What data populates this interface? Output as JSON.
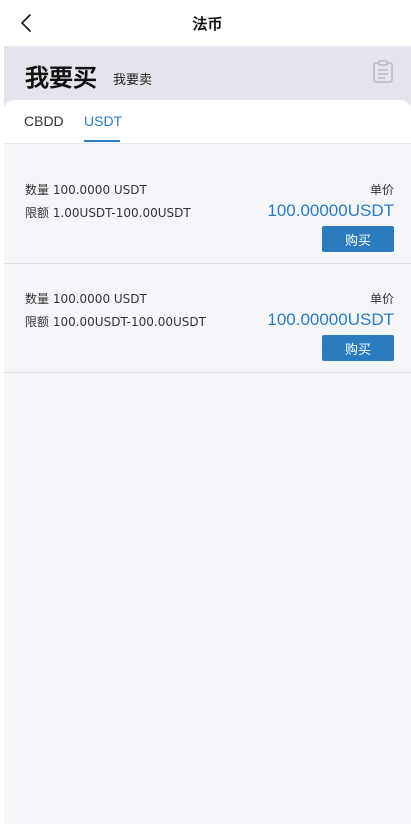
{
  "header": {
    "title": "法币"
  },
  "hero": {
    "buy_label": "我要买",
    "sell_label": "我要卖"
  },
  "tabs": [
    {
      "label": "CBDD",
      "active": false
    },
    {
      "label": "USDT",
      "active": true
    }
  ],
  "offers": [
    {
      "quantity_text": "数量 100.0000 USDT",
      "limit_text": "限额 1.00USDT-100.00USDT",
      "unit_price_label": "单价",
      "price": "100.00000USDT",
      "action_label": "购买"
    },
    {
      "quantity_text": "数量 100.0000 USDT",
      "limit_text": "限额 100.00USDT-100.00USDT",
      "unit_price_label": "单价",
      "price": "100.00000USDT",
      "action_label": "购买"
    }
  ],
  "colors": {
    "accent": "#2a7bc0",
    "hero_bg": "#e4e5ec",
    "page_bg": "#f5f6fa"
  },
  "icons": {
    "back": "chevron-left-icon",
    "orders": "clipboard-icon"
  }
}
